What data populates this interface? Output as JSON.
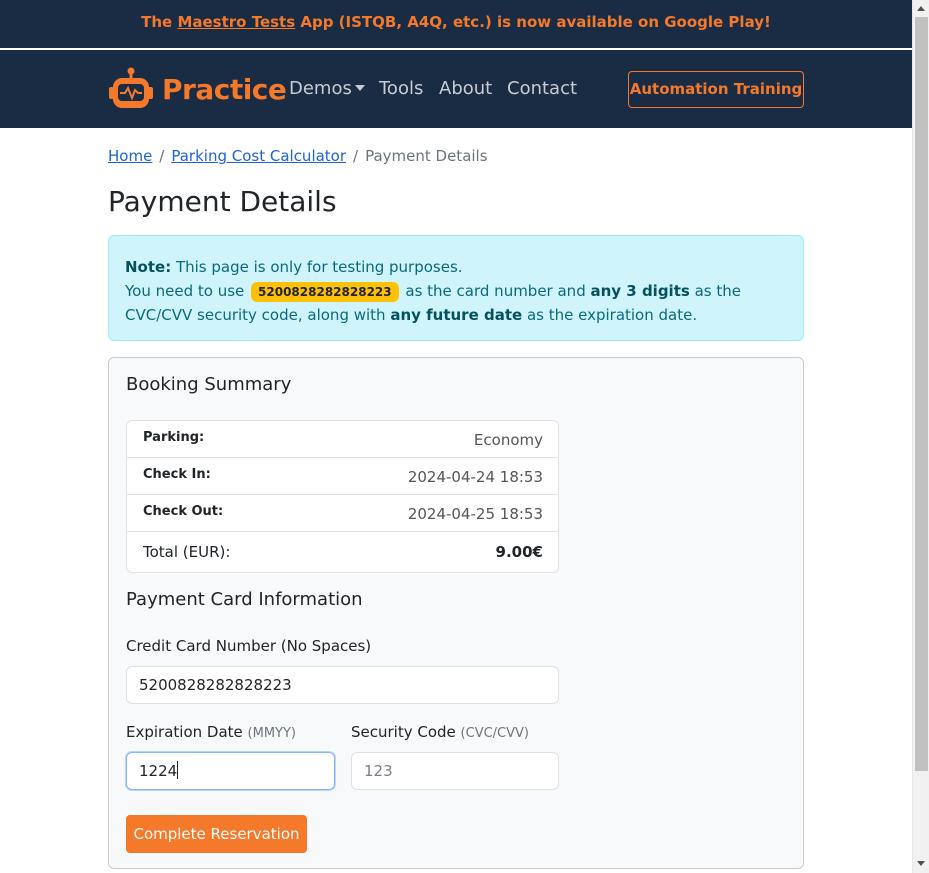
{
  "announcement": {
    "prefix": "The ",
    "link": "Maestro Tests",
    "suffix": " App (ISTQB, A4Q, etc.) is now available on Google Play!"
  },
  "navbar": {
    "brand": "Practice",
    "links": [
      "Demos",
      "Tools",
      "About",
      "Contact"
    ],
    "cta": "Automation Training"
  },
  "breadcrumb": {
    "home": "Home",
    "parent": "Parking Cost Calculator",
    "current": "Payment Details",
    "separator": "/"
  },
  "page_title": "Payment Details",
  "note": {
    "label": "Note:",
    "line1": " This page is only for testing purposes.",
    "line2_prefix": "You need to use ",
    "card_number": "5200828282828223",
    "line2_mid": " as the card number and ",
    "digits": "any 3 digits",
    "line2_suffix": " as the CVC/CVV security code, along with ",
    "future": "any future date",
    "line3_suffix": " as the expiration date."
  },
  "summary": {
    "title": "Booking Summary",
    "rows": [
      {
        "label": "Parking:",
        "value": "Economy"
      },
      {
        "label": "Check In:",
        "value": "2024-04-24 18:53"
      },
      {
        "label": "Check Out:",
        "value": "2024-04-25 18:53"
      }
    ],
    "total_label": "Total (EUR):",
    "total_value": "9.00€"
  },
  "payment": {
    "title": "Payment Card Information",
    "card_label": "Credit Card Number (No Spaces)",
    "card_value": "5200828282828223",
    "exp_label": "Expiration Date",
    "exp_hint": "(MMYY)",
    "exp_value": "1224",
    "cvc_label": "Security Code",
    "cvc_hint": "(CVC/CVV)",
    "cvc_placeholder": "123",
    "submit": "Complete Reservation"
  },
  "colors": {
    "navy": "#1a2b44",
    "orange": "#f4792a",
    "info_bg": "#cff4fc"
  }
}
